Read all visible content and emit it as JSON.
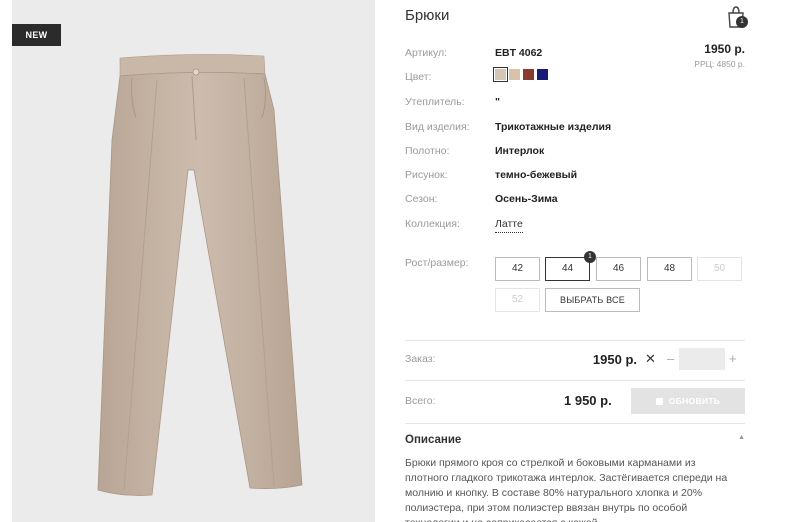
{
  "badge": "NEW",
  "product": {
    "title": "Брюки",
    "cart_count": "1",
    "price": "1950 р.",
    "rrp": "РРЦ: 4850 р."
  },
  "specs": [
    {
      "label": "Артикул:",
      "value": "EBT 4062"
    },
    {
      "label": "Цвет:",
      "value": ""
    },
    {
      "label": "Утеплитель:",
      "value": "\""
    },
    {
      "label": "Вид изделия:",
      "value": "Трикотажные изделия"
    },
    {
      "label": "Полотно:",
      "value": "Интерлок"
    },
    {
      "label": "Рисунок:",
      "value": "темно-бежевый"
    },
    {
      "label": "Сезон:",
      "value": "Осень-Зима"
    },
    {
      "label": "Коллекция:",
      "value": "Латте"
    }
  ],
  "colors": [
    "#d4c6b4",
    "#d6c3a9",
    "#8b3a2e",
    "#1a1a7a"
  ],
  "sizes": {
    "label": "Рост/размер:",
    "items": [
      "42",
      "44",
      "46",
      "48",
      "50",
      "52"
    ],
    "selected": "44",
    "selected_count": "1",
    "disabled": [
      "50",
      "52"
    ],
    "select_all": "ВЫБРАТЬ ВСЕ"
  },
  "order": {
    "label": "Заказ:",
    "price": "1950 р.",
    "remove": "✕",
    "minus": "–",
    "plus": "+"
  },
  "total": {
    "label": "Всего:",
    "price": "1 950 р.",
    "button": "ОБНОВИТЬ"
  },
  "description": {
    "heading": "Описание",
    "text": "Брюки прямого кроя со стрелкой и боковыми карманами из плотного гладкого трикотажа интерлок. Застёгивается спереди на молнию и кнопку. В составе 80% натурального хлопка и 20% полиэстера, при этом полиэстер ввязан внутрь по особой технологии и не соприкасается с кожей."
  }
}
